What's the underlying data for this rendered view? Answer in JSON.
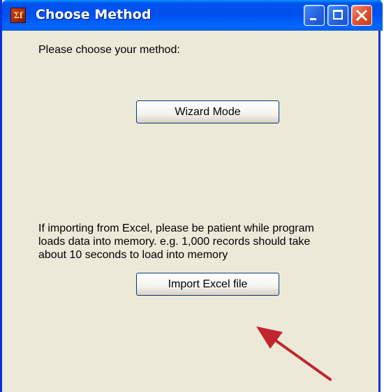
{
  "window": {
    "title": "Choose Method",
    "app_icon_text": "Σf"
  },
  "content": {
    "prompt": "Please choose your method:",
    "wizard_button": "Wizard Mode",
    "excel_note_lines": [
      "If importing from Excel, please be patient while program",
      "loads data into memory. e.g. 1,000 records should take",
      "about 10 seconds to load into memory"
    ],
    "import_button": "Import Excel file"
  },
  "annotation": {
    "arrow_color": "#c0262d",
    "arrow_icon": "red-arrow-icon"
  }
}
